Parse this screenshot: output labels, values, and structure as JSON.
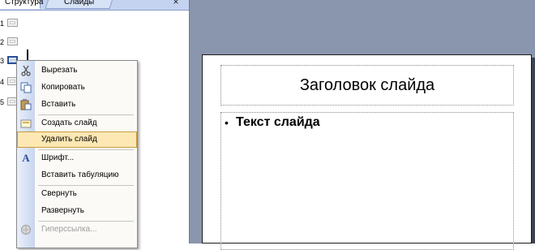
{
  "tabs": {
    "outline_label": "Структура",
    "slides_label": "Слайды",
    "close_label": "×"
  },
  "outline": {
    "slides": [
      {
        "number": "1"
      },
      {
        "number": "2"
      },
      {
        "number": "3",
        "active": true
      },
      {
        "number": "4"
      },
      {
        "number": "5"
      }
    ]
  },
  "context_menu": {
    "items": [
      {
        "label": "Вырезать",
        "icon": "scissors-icon",
        "enabled": true
      },
      {
        "label": "Копировать",
        "icon": "copy-icon",
        "enabled": true
      },
      {
        "label": "Вставить",
        "icon": "paste-icon",
        "enabled": true
      },
      {
        "label": "Создать слайд",
        "icon": "new-slide-icon",
        "enabled": true
      },
      {
        "label": "Удалить слайд",
        "icon": "",
        "enabled": true,
        "highlighted": true
      },
      {
        "label": "Шрифт...",
        "icon": "font-icon",
        "enabled": true
      },
      {
        "label": "Вставить табуляцию",
        "icon": "",
        "enabled": true
      },
      {
        "label": "Свернуть",
        "icon": "",
        "enabled": true
      },
      {
        "label": "Развернуть",
        "icon": "",
        "enabled": true
      },
      {
        "label": "Гиперссылка...",
        "icon": "hyperlink-icon",
        "enabled": false
      }
    ]
  },
  "slide": {
    "title": "Заголовок слайда",
    "bullet": "•",
    "body_text": "Текст слайда"
  },
  "colors": {
    "workspace": "#8a96ad",
    "tab_strip": "#c4d3f0",
    "menu_highlight": "#fde7b3",
    "menu_highlight_border": "#c99b3d"
  }
}
